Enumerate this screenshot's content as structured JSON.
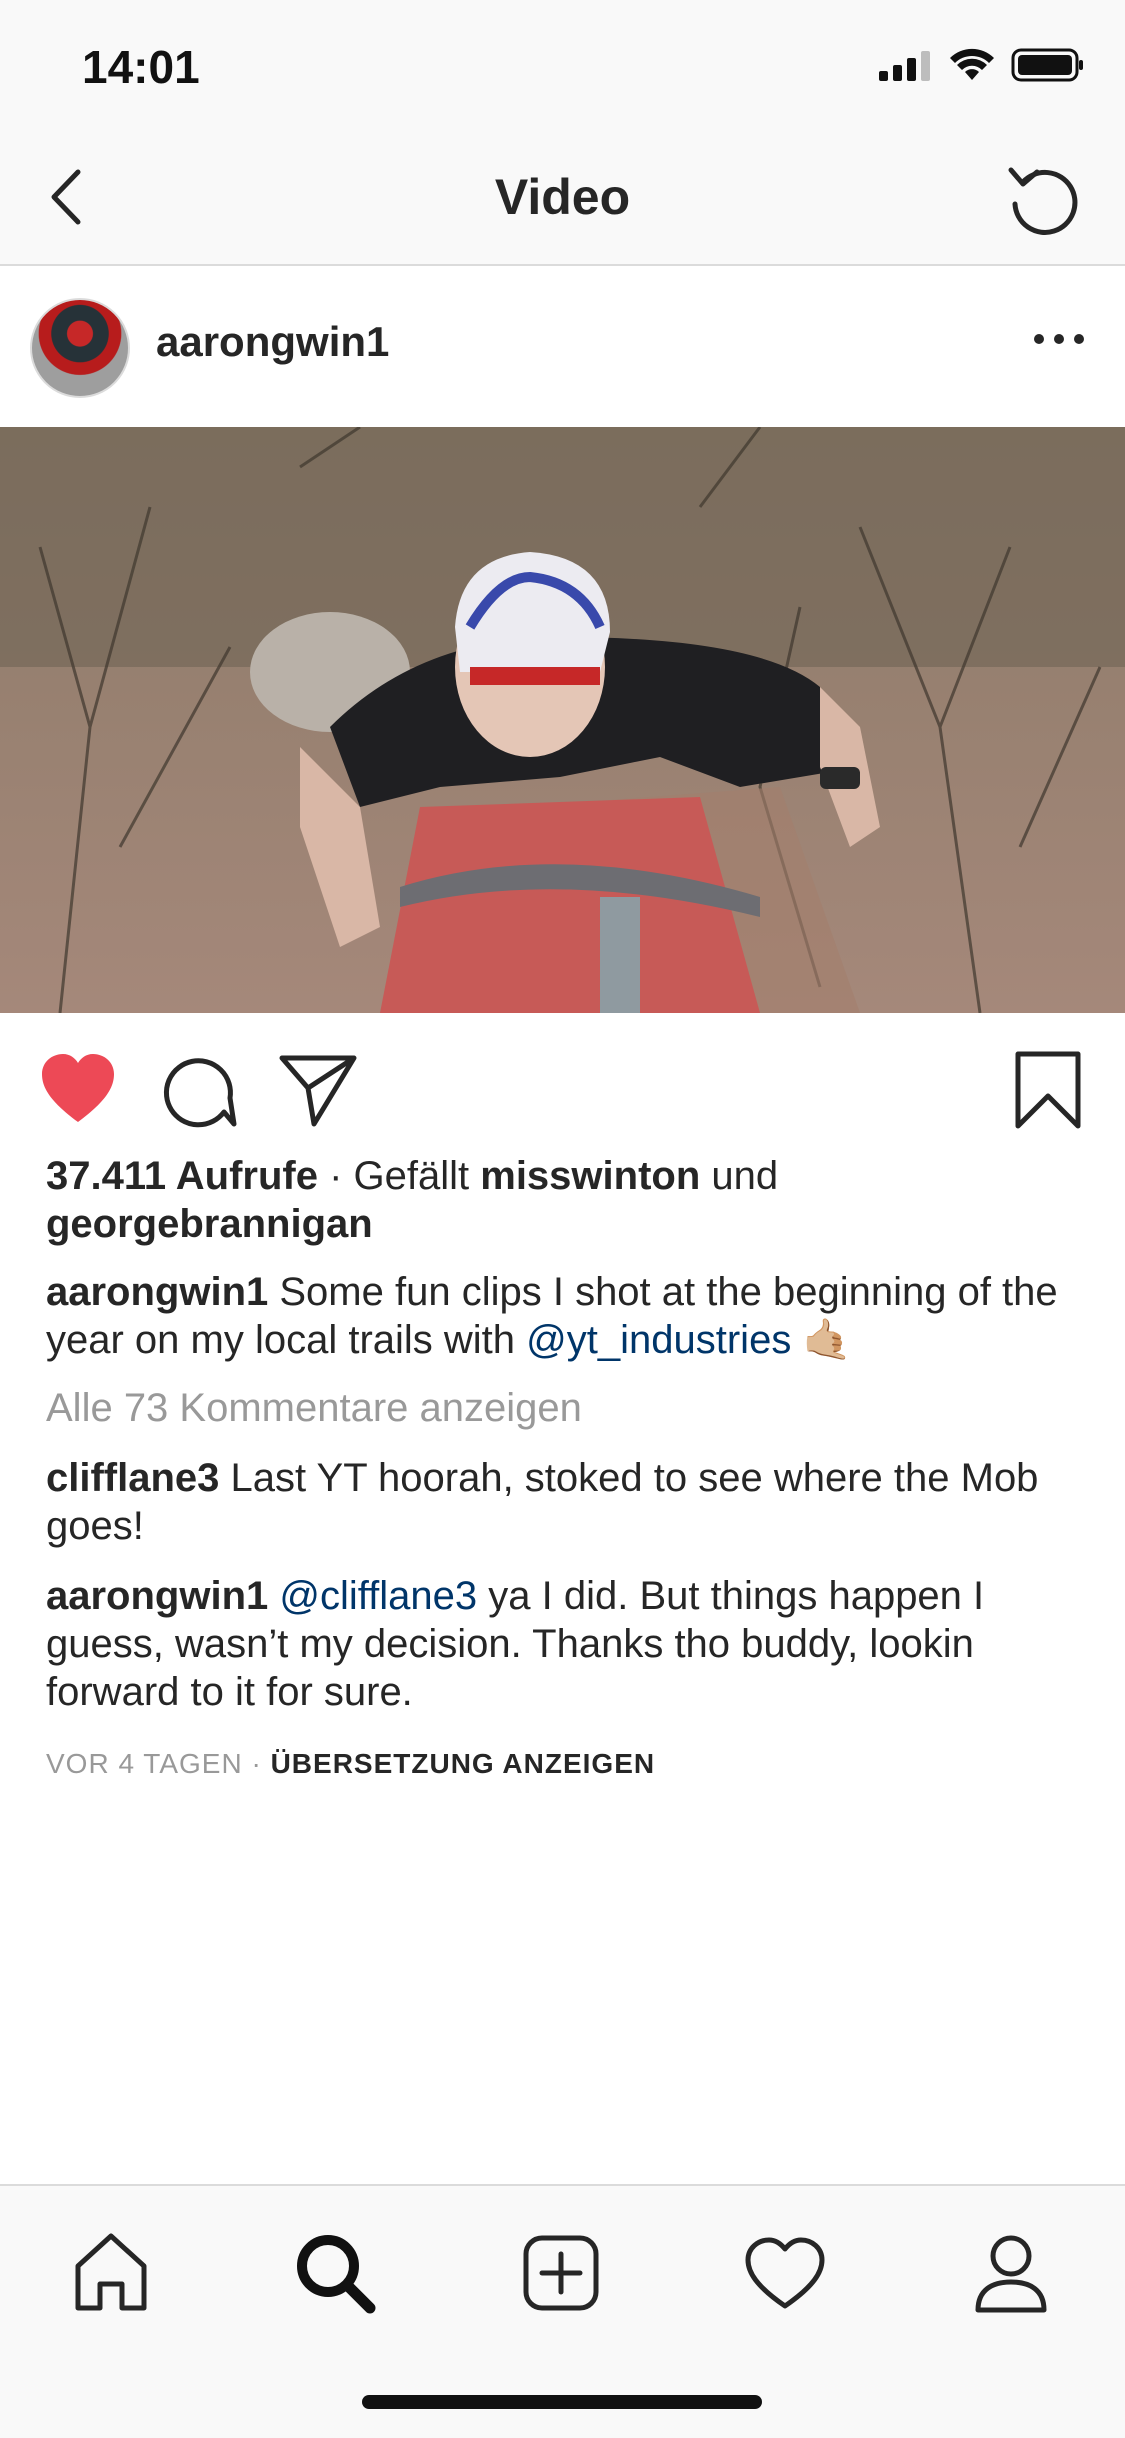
{
  "status_bar": {
    "time": "14:01"
  },
  "nav": {
    "title": "Video"
  },
  "post": {
    "username": "aarongwin1",
    "views": "37.411 Aufrufe",
    "liked_by_prefix": " · Gefällt ",
    "liked_by_user1": "misswinton",
    "liked_by_and": " und",
    "liked_by_user2": "georgebrannigan",
    "caption": {
      "username": "aarongwin1",
      "text": " Some fun clips I shot at the beginning of the year on my local trails with ",
      "mention": "@yt_industries",
      "emoji": " 🤙🏼"
    },
    "view_all_comments": "Alle 73 Kommentare anzeigen",
    "comments": [
      {
        "username": "clifflane3",
        "mention": "",
        "text": " Last YT hoorah, stoked to see where the Mob goes!"
      },
      {
        "username": "aarongwin1",
        "mention": " @clifflane3",
        "text": " ya I did. But things happen I guess, wasn’t my decision. Thanks tho buddy, lookin forward to it for sure."
      }
    ],
    "time_ago": "VOR 4 TAGEN",
    "separator": " · ",
    "translate_label": "ÜBERSETZUNG ANZEIGEN"
  },
  "colors": {
    "like": "#ED4956",
    "mention": "#003569",
    "muted": "#999999",
    "text": "#262626"
  },
  "icons": {
    "nav": [
      "back-icon",
      "refresh-icon"
    ],
    "actions": [
      "heart-icon",
      "comment-icon",
      "share-icon",
      "bookmark-icon"
    ],
    "tabs": [
      "home-icon",
      "search-icon",
      "add-icon",
      "activity-icon",
      "profile-icon"
    ]
  }
}
